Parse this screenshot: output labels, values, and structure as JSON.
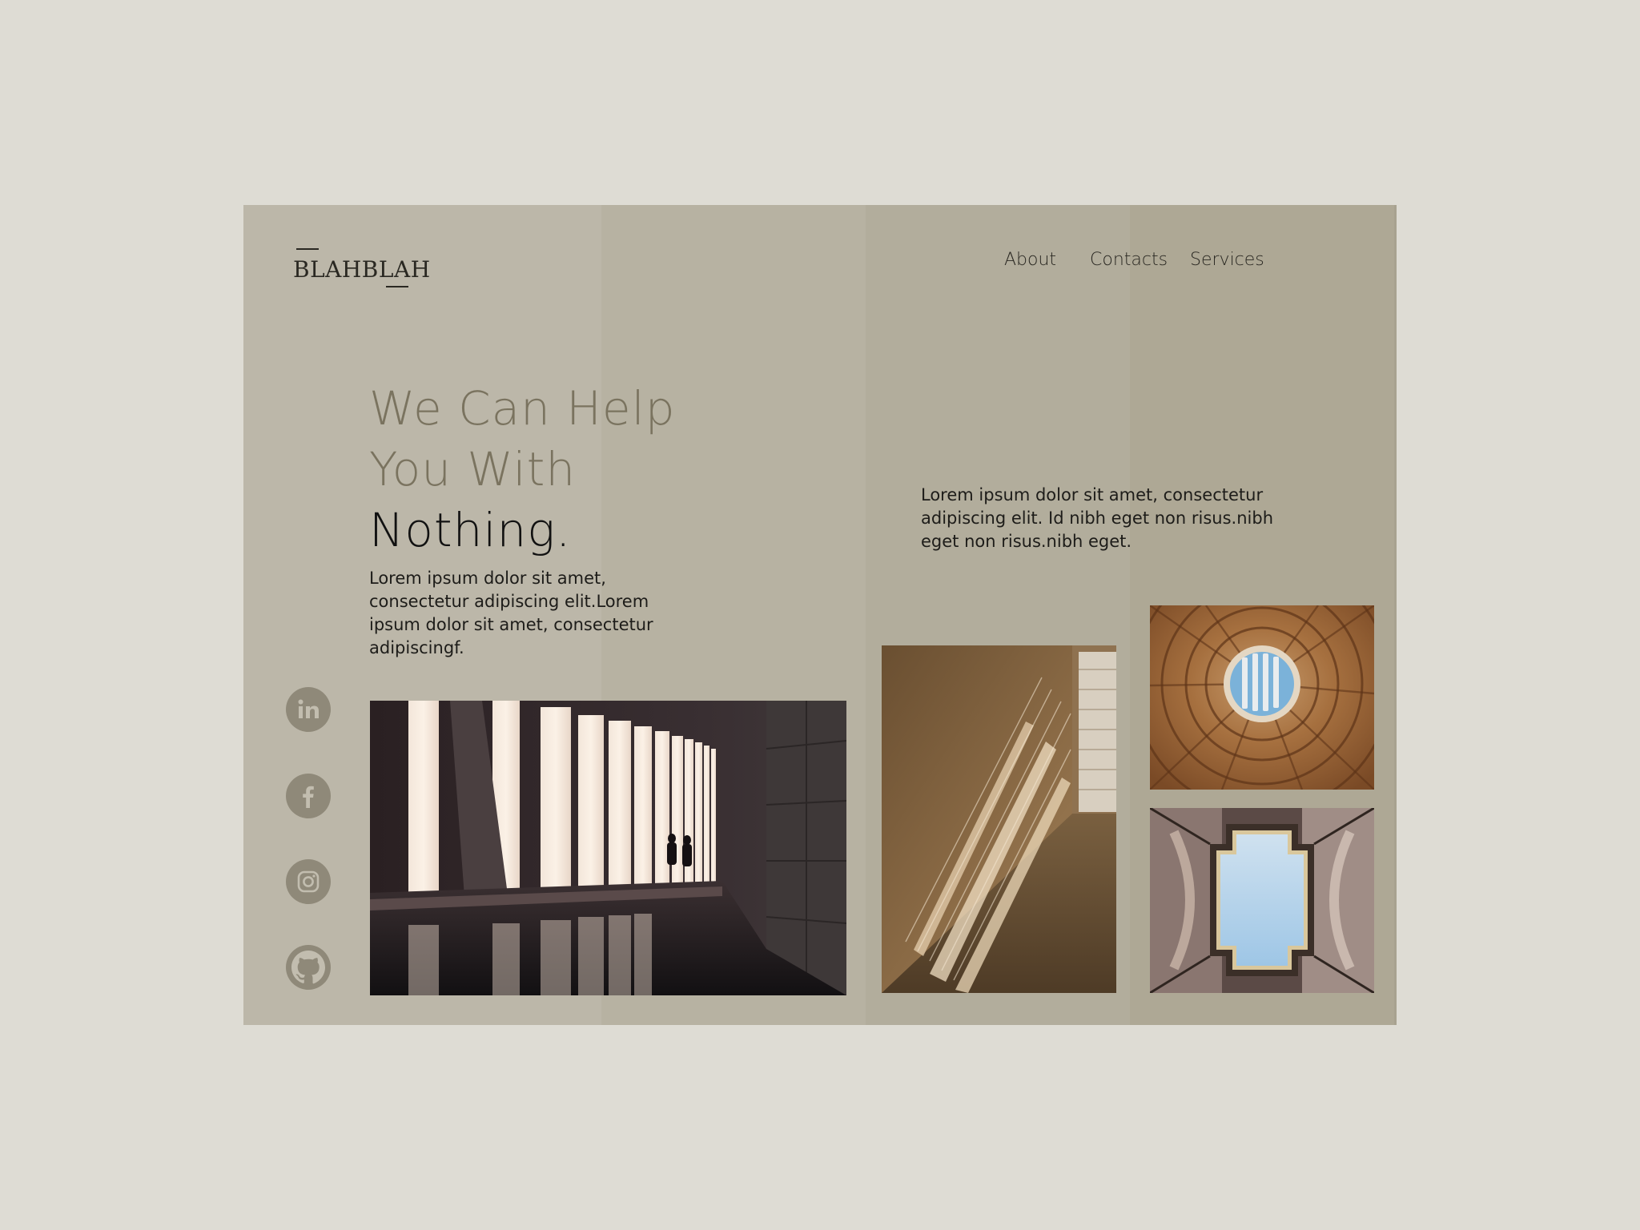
{
  "brand": {
    "logo_text": "BLAHBLAH"
  },
  "nav": {
    "items": [
      {
        "label": "About"
      },
      {
        "label": "Contacts"
      },
      {
        "label": "Services"
      }
    ]
  },
  "hero": {
    "line1": "We Can Help",
    "line2": "You With",
    "line3": "Nothing.",
    "body": "Lorem ipsum dolor sit amet, consectetur adipiscing elit.Lorem ipsum dolor sit amet, consectetur adipiscingf."
  },
  "side": {
    "body": "Lorem ipsum dolor sit amet, consectetur adipiscing elit. Id nibh eget non risus.nibh eget non risus.nibh eget."
  },
  "social": [
    {
      "icon": "linkedin-icon"
    },
    {
      "icon": "facebook-icon"
    },
    {
      "icon": "instagram-icon"
    },
    {
      "icon": "github-icon"
    }
  ],
  "colors": {
    "page_bg": "#dedcd4",
    "card_bg": "#b1ac9b",
    "heading_muted": "#7a735f",
    "heading_dark": "#111111",
    "social_circle": "#8f8979"
  }
}
